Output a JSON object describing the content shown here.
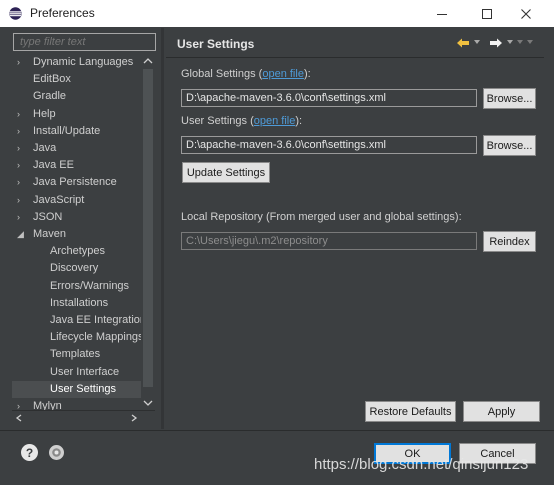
{
  "window": {
    "title": "Preferences",
    "minimize_glyph": "—",
    "maximize_glyph": "☐",
    "close_glyph": "✕"
  },
  "sidebar": {
    "filter_placeholder": "type filter text",
    "tree": [
      {
        "label": "Dynamic Languages",
        "expander": "›"
      },
      {
        "label": "EditBox",
        "expander": ""
      },
      {
        "label": "Gradle",
        "expander": ""
      },
      {
        "label": "Help",
        "expander": "›"
      },
      {
        "label": "Install/Update",
        "expander": "›"
      },
      {
        "label": "Java",
        "expander": "›"
      },
      {
        "label": "Java EE",
        "expander": "›"
      },
      {
        "label": "Java Persistence",
        "expander": "›"
      },
      {
        "label": "JavaScript",
        "expander": "›"
      },
      {
        "label": "JSON",
        "expander": "›"
      },
      {
        "label": "Maven",
        "expander": "◢"
      },
      {
        "label": "Archetypes",
        "expander": ""
      },
      {
        "label": "Discovery",
        "expander": ""
      },
      {
        "label": "Errors/Warnings",
        "expander": ""
      },
      {
        "label": "Installations",
        "expander": ""
      },
      {
        "label": "Java EE Integration",
        "expander": ""
      },
      {
        "label": "Lifecycle Mappings",
        "expander": ""
      },
      {
        "label": "Templates",
        "expander": ""
      },
      {
        "label": "User Interface",
        "expander": ""
      },
      {
        "label": "User Settings",
        "expander": ""
      },
      {
        "label": "Mylyn",
        "expander": "›"
      }
    ],
    "selected_label": "User Settings"
  },
  "page": {
    "title": "User Settings",
    "global_label": "Global Settings",
    "global_link": "open file",
    "global_value": "D:\\apache-maven-3.6.0\\conf\\settings.xml",
    "user_label": "User Settings",
    "user_link": "open file",
    "user_value": "D:\\apache-maven-3.6.0\\conf\\settings.xml",
    "browse_label": "Browse...",
    "update_label": "Update Settings",
    "repo_label": "Local Repository (From merged user and global settings):",
    "repo_value": "C:\\Users\\jiegu\\.m2\\repository",
    "reindex_label": "Reindex",
    "restore_label": "Restore Defaults",
    "apply_label": "Apply"
  },
  "footer": {
    "ok_label": "OK",
    "cancel_label": "Cancel",
    "help_glyph": "?",
    "watermark": "https://blog.csdn.net/qinsijun123"
  },
  "colors": {
    "background": "#3c3f41",
    "link": "#4e9bd8",
    "default_button_border": "#0078d7",
    "selection": "#4b4e50"
  }
}
